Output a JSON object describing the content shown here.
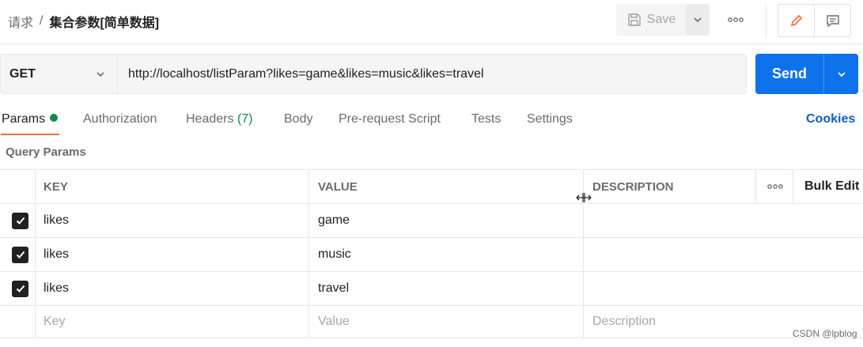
{
  "header": {
    "breadcrumb_parent": "请求",
    "breadcrumb_sep": "/",
    "breadcrumb_current": "集合参数[简单数据]",
    "save_label": "Save"
  },
  "request": {
    "method": "GET",
    "url": "http://localhost/listParam?likes=game&likes=music&likes=travel",
    "send_label": "Send"
  },
  "tabs": {
    "params": "Params",
    "authorization": "Authorization",
    "headers": "Headers",
    "headers_count": "(7)",
    "body": "Body",
    "prerequest": "Pre-request Script",
    "tests": "Tests",
    "settings": "Settings",
    "cookies": "Cookies"
  },
  "query": {
    "title": "Query Params",
    "columns": {
      "key": "KEY",
      "value": "VALUE",
      "description": "DESCRIPTION",
      "bulk_edit": "Bulk Edit"
    },
    "rows": [
      {
        "key": "likes",
        "value": "game",
        "checked": true
      },
      {
        "key": "likes",
        "value": "music",
        "checked": true
      },
      {
        "key": "likes",
        "value": "travel",
        "checked": true
      }
    ],
    "placeholder": {
      "key": "Key",
      "value": "Value",
      "description": "Description"
    }
  },
  "watermark": "CSDN @lpblog",
  "colors": {
    "accent": "#0d72eb",
    "tab_underline": "#f26b3a",
    "status_green": "#0f8a4c",
    "link": "#0d5fbf"
  }
}
